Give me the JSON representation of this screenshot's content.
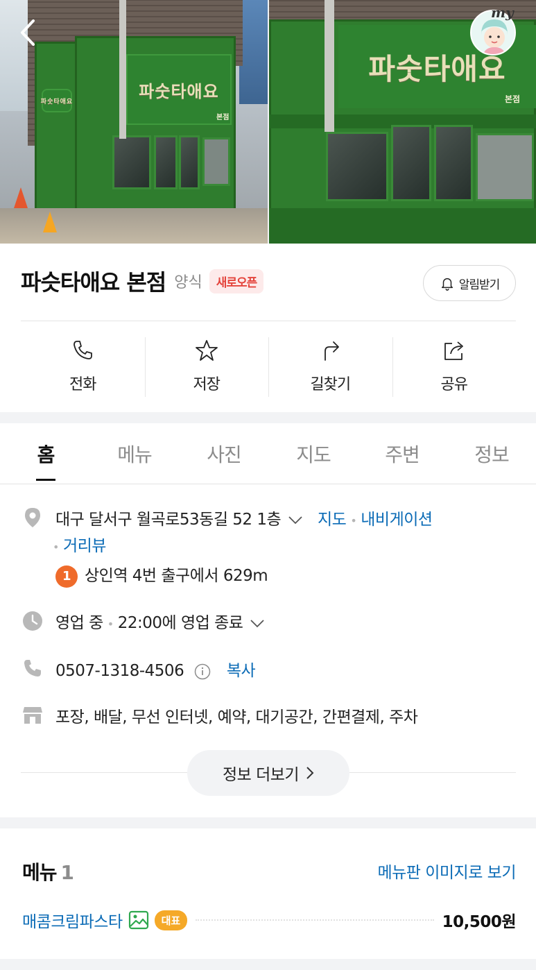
{
  "header": {
    "store_sign_text": "파숫타애요",
    "store_sign_sub": "본점",
    "avatar_label": "my"
  },
  "place": {
    "name": "파슷타애요 본점",
    "category": "양식",
    "badge": "새로오픈",
    "notify_label": "알림받기"
  },
  "actions": [
    {
      "label": "전화",
      "icon": "phone-icon"
    },
    {
      "label": "저장",
      "icon": "star-icon"
    },
    {
      "label": "길찾기",
      "icon": "directions-icon"
    },
    {
      "label": "공유",
      "icon": "share-icon"
    }
  ],
  "tabs": [
    {
      "label": "홈",
      "active": true
    },
    {
      "label": "메뉴"
    },
    {
      "label": "사진"
    },
    {
      "label": "지도"
    },
    {
      "label": "주변"
    },
    {
      "label": "정보"
    }
  ],
  "details": {
    "address": "대구 달서구 월곡로53동길 52 1층",
    "map_link": "지도",
    "navigation_link": "내비게이션",
    "street_view_link": "거리뷰",
    "subway_line": "1",
    "subway_text": "상인역 4번 출구에서 629m",
    "hours_status": "영업 중",
    "hours_text": "22:00에 영업 종료",
    "phone": "0507-1318-4506",
    "copy_label": "복사",
    "amenities": "포장, 배달, 무선 인터넷, 예약, 대기공간, 간편결제, 주차",
    "more_label": "정보 더보기"
  },
  "menu": {
    "title": "메뉴",
    "count": "1",
    "image_link": "메뉴판 이미지로 보기",
    "items": [
      {
        "name": "매콤크림파스타",
        "badge": "대표",
        "price": "10,500원"
      }
    ]
  },
  "colors": {
    "accent_link": "#0b6bb6",
    "new_badge": "#e4443c",
    "subway_line1": "#ef6b2b",
    "rep_badge": "#f5a928",
    "storefront_green": "#2f7d2e"
  }
}
